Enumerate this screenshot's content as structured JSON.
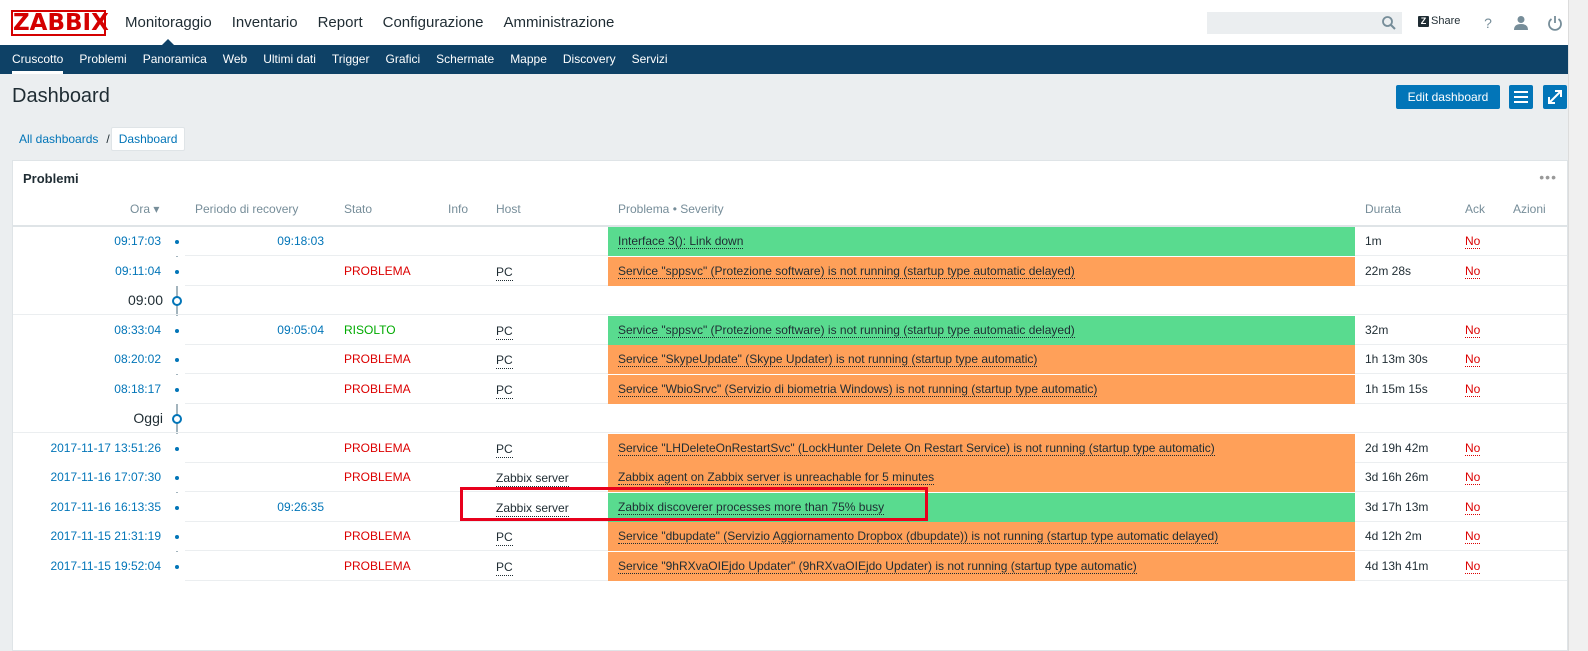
{
  "header": {
    "logo": "ZABBIX",
    "nav": [
      "Monitoraggio",
      "Inventario",
      "Report",
      "Configurazione",
      "Amministrazione"
    ],
    "search_placeholder": "",
    "share_badge": "Z",
    "share_label": "Share",
    "help_icon": "?"
  },
  "subnav": [
    "Cruscotto",
    "Problemi",
    "Panoramica",
    "Web",
    "Ultimi dati",
    "Trigger",
    "Grafici",
    "Schermate",
    "Mappe",
    "Discovery",
    "Servizi"
  ],
  "page": {
    "title": "Dashboard",
    "edit_button": "Edit dashboard",
    "breadcrumb": [
      "All dashboards",
      "/",
      "Dashboard"
    ]
  },
  "widget": {
    "title": "Problemi",
    "menu": "•••",
    "columns": {
      "ora": "Ora ▾",
      "recovery": "Periodo di recovery",
      "stato": "Stato",
      "info": "Info",
      "host": "Host",
      "problema": "Problema • Severity",
      "durata": "Durata",
      "ack": "Ack",
      "azioni": "Azioni"
    },
    "rows": [
      {
        "time": "09:17:03",
        "recovery": "09:18:03",
        "stato": "",
        "host": "",
        "problem": "Interface 3(): Link down",
        "severity_color": "#59db8f",
        "durata": "1m",
        "ack": "No"
      },
      {
        "time": "09:11:04",
        "recovery": "",
        "stato": "PROBLEMA",
        "host": "PC",
        "problem": "Service \"sppsvc\" (Protezione software) is not running (startup type automatic delayed)",
        "severity_color": "#ffa059",
        "durata": "22m 28s",
        "ack": "No"
      },
      {
        "divider": "09:00"
      },
      {
        "time": "08:33:04",
        "recovery": "09:05:04",
        "stato": "RISOLTO",
        "host": "PC",
        "problem": "Service \"sppsvc\" (Protezione software) is not running (startup type automatic delayed)",
        "severity_color": "#59db8f",
        "durata": "32m",
        "ack": "No"
      },
      {
        "time": "08:20:02",
        "recovery": "",
        "stato": "PROBLEMA",
        "host": "PC",
        "problem": "Service \"SkypeUpdate\" (Skype Updater) is not running (startup type automatic)",
        "severity_color": "#ffa059",
        "durata": "1h 13m 30s",
        "ack": "No"
      },
      {
        "time": "08:18:17",
        "recovery": "",
        "stato": "PROBLEMA",
        "host": "PC",
        "problem": "Service \"WbioSrvc\" (Servizio di biometria Windows) is not running (startup type automatic)",
        "severity_color": "#ffa059",
        "durata": "1h 15m 15s",
        "ack": "No"
      },
      {
        "divider": "Oggi"
      },
      {
        "time": "2017-11-17 13:51:26",
        "recovery": "",
        "stato": "PROBLEMA",
        "host": "PC",
        "problem": "Service \"LHDeleteOnRestartSvc\" (LockHunter Delete On Restart Service) is not running (startup type automatic)",
        "severity_color": "#ffa059",
        "durata": "2d 19h 42m",
        "ack": "No"
      },
      {
        "time": "2017-11-16 17:07:30",
        "recovery": "",
        "stato": "PROBLEMA",
        "host": "Zabbix server",
        "problem": "Zabbix agent on Zabbix server is unreachable for 5 minutes",
        "severity_color": "#ffa059",
        "durata": "3d 16h 26m",
        "ack": "No"
      },
      {
        "time": "2017-11-16 16:13:35",
        "recovery": "09:26:35",
        "stato": "",
        "host": "Zabbix server",
        "problem": "Zabbix discoverer processes more than 75% busy",
        "severity_color": "#59db8f",
        "durata": "3d 17h 13m",
        "ack": "No"
      },
      {
        "time": "2017-11-15 21:31:19",
        "recovery": "",
        "stato": "PROBLEMA",
        "host": "PC",
        "problem": "Service \"dbupdate\" (Servizio Aggiornamento Dropbox (dbupdate)) is not running (startup type automatic delayed)",
        "severity_color": "#ffa059",
        "durata": "4d 12h 2m",
        "ack": "No"
      },
      {
        "time": "2017-11-15 19:52:04",
        "recovery": "",
        "stato": "PROBLEMA",
        "host": "PC",
        "problem": "Service \"9hRXvaOIEjdo Updater\" (9hRXvaOIEjdo Updater) is not running (startup type automatic)",
        "severity_color": "#ffa059",
        "durata": "4d 13h 41m",
        "ack": "No"
      }
    ]
  }
}
